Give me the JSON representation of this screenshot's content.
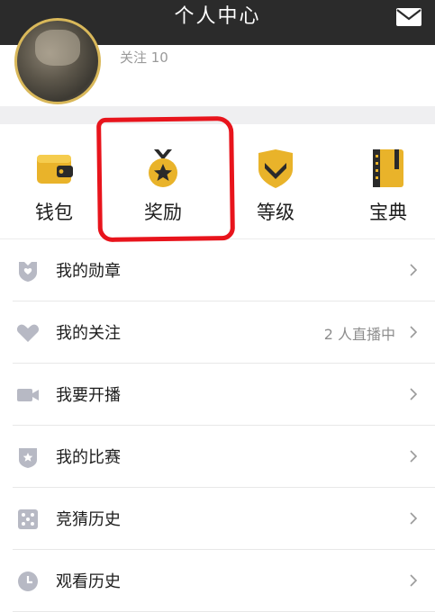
{
  "header": {
    "title": "个人中心",
    "mail_icon": "mail-icon"
  },
  "profile": {
    "follow_text": "关注 10"
  },
  "quick_actions": [
    {
      "label": "钱包",
      "icon": "wallet-icon",
      "color": "#e9b32a"
    },
    {
      "label": "奖励",
      "icon": "medal-icon",
      "color": "#e9b32a"
    },
    {
      "label": "等级",
      "icon": "shield-level-icon",
      "color": "#e9b32a"
    },
    {
      "label": "宝典",
      "icon": "book-icon",
      "color": "#e9b32a"
    }
  ],
  "menu": [
    {
      "label": "我的勋章",
      "info": "",
      "icon": "badge-icon"
    },
    {
      "label": "我的关注",
      "info": "2 人直播中",
      "icon": "heart-icon"
    },
    {
      "label": "我要开播",
      "info": "",
      "icon": "camera-icon"
    },
    {
      "label": "我的比赛",
      "info": "",
      "icon": "star-shield-icon"
    },
    {
      "label": "竞猜历史",
      "info": "",
      "icon": "dice-icon"
    },
    {
      "label": "观看历史",
      "info": "",
      "icon": "clock-icon"
    }
  ],
  "colors": {
    "header_bg": "#2b2b2b",
    "accent": "#e9b32a",
    "annotation": "#e8141c",
    "icon_gray": "#b7b9c4"
  }
}
